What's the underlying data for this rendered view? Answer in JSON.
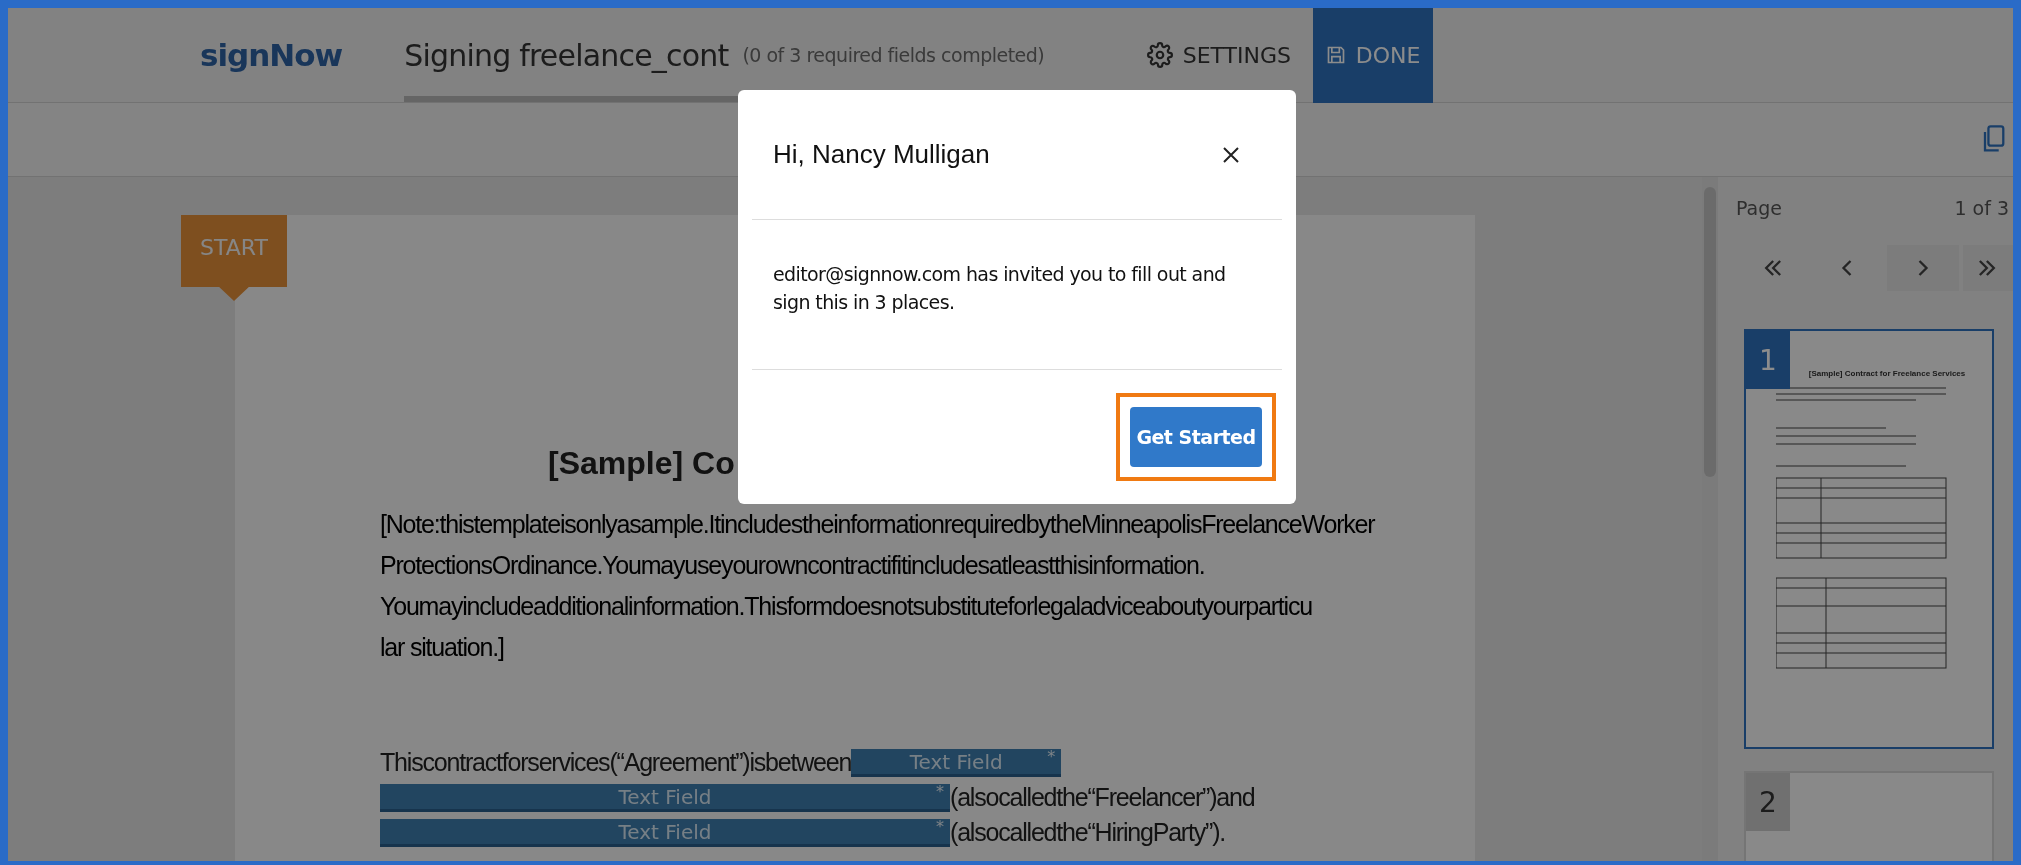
{
  "header": {
    "logo": "signNow",
    "title": "Signing freelance_cont",
    "progress": "(0 of 3 required fields completed)",
    "settings": "SETTINGS",
    "done": "DONE"
  },
  "start_tag": "START",
  "document": {
    "title": "[Sample] Co",
    "note_lines": [
      "[Note:thistemplateisonlyasample.ItincludestheinformationrequiredbytheMinneapolisFreelanceWorker",
      "ProtectionsOrdinance.Youmayuseyourowncontractifitincludesatleastthisinformation.",
      "Youmayincludeadditionalinformation.Thisformdoesnotsubstituteforlegaladviceaboutyourparticu",
      "lar situation.]"
    ],
    "contract_rows": [
      {
        "before": "Thiscontractforservices(“Agreement”)isbetween",
        "field": {
          "label": "Text Field",
          "mark": "*"
        }
      },
      {
        "field": {
          "label": "Text Field",
          "mark": "*"
        },
        "after": "(alsocalledthe“Freelancer”)and"
      },
      {
        "field": {
          "label": "Text Field",
          "mark": "*"
        },
        "after": "(alsocalledthe“HiringParty”)."
      }
    ]
  },
  "pages_panel": {
    "label": "Page",
    "count": "1 of 3",
    "thumbnails": [
      {
        "number": "1",
        "selected": true,
        "heading": "[Sample] Contract for Freelance Services"
      },
      {
        "number": "2",
        "selected": false
      }
    ]
  },
  "modal": {
    "title": "Hi, Nancy Mulligan",
    "message": "editor@signnow.com has invited you to fill out and sign this in 3 places.",
    "button": "Get Started",
    "button_highlighted": true
  }
}
